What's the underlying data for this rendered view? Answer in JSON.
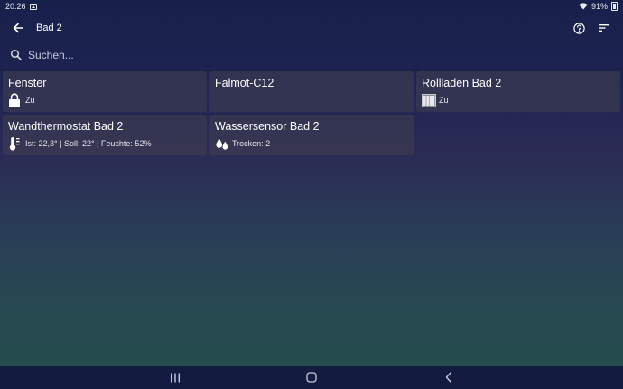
{
  "status_bar": {
    "time": "20:26",
    "battery": "91%"
  },
  "app_bar": {
    "title": "Bad 2"
  },
  "search": {
    "placeholder": "Suchen..."
  },
  "tiles": [
    {
      "title": "Fenster",
      "subtitle": "Zu",
      "icon": "lock-icon"
    },
    {
      "title": "Falmot-C12",
      "subtitle": "",
      "icon": ""
    },
    {
      "title": "Rollladen Bad 2",
      "subtitle": "Zu",
      "icon": "shutter-icon"
    },
    {
      "title": "Wandthermostat Bad 2",
      "subtitle": "Ist: 22,3° | Soll: 22° | Feuchte: 52%",
      "icon": "thermometer-icon"
    },
    {
      "title": "Wassersensor Bad 2",
      "subtitle": "Trocken: 2",
      "icon": "water-drops-icon"
    }
  ],
  "nav_bar": {
    "buttons": [
      "recents-icon",
      "home-icon",
      "back-icon"
    ]
  }
}
